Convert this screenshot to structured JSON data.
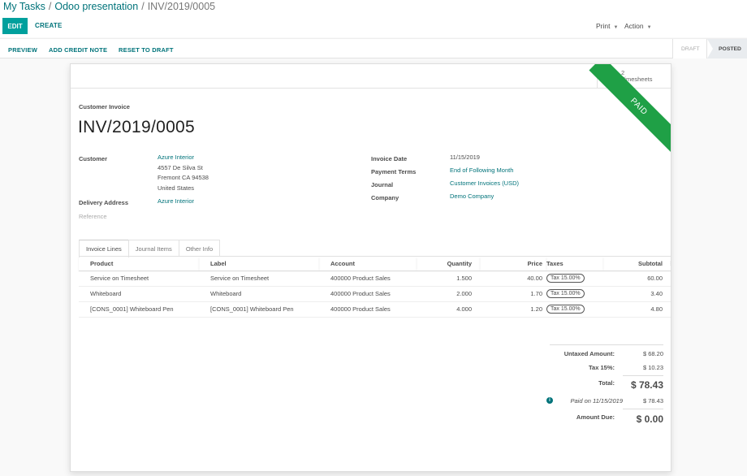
{
  "breadcrumb": [
    {
      "label": "My Tasks",
      "link": true
    },
    {
      "label": "Odoo presentation",
      "link": true
    },
    {
      "label": "INV/2019/0005",
      "link": false
    }
  ],
  "breadcrumb_separator": "/",
  "toolbar": {
    "edit_label": "EDIT",
    "create_label": "CREATE",
    "print_label": "Print",
    "action_label": "Action"
  },
  "statusbar": {
    "buttons": [
      "PREVIEW",
      "ADD CREDIT NOTE",
      "RESET TO DRAFT"
    ],
    "steps": [
      {
        "label": "DRAFT",
        "active": false
      },
      {
        "label": "POSTED",
        "active": true
      }
    ]
  },
  "smart_button": {
    "icon": "calendar-icon",
    "count": "2",
    "label": "Timesheets"
  },
  "ribbon": {
    "text": "PAID",
    "color": "#1fa046"
  },
  "document": {
    "type_label": "Customer Invoice",
    "number": "INV/2019/0005"
  },
  "left_fields": {
    "customer_label": "Customer",
    "customer_name": "Azure Interior",
    "customer_address": [
      "4557 De Silva St",
      "Fremont CA 94538",
      "United States"
    ],
    "delivery_label": "Delivery Address",
    "delivery_value": "Azure Interior",
    "reference_label": "Reference"
  },
  "right_fields": [
    {
      "label": "Invoice Date",
      "value": "11/15/2019",
      "link": false
    },
    {
      "label": "Payment Terms",
      "value": "End of Following Month",
      "link": true
    },
    {
      "label": "Journal",
      "value": "Customer Invoices (USD)",
      "link": true
    },
    {
      "label": "Company",
      "value": "Demo Company",
      "link": true
    }
  ],
  "tabs": [
    {
      "label": "Invoice Lines",
      "active": true
    },
    {
      "label": "Journal Items",
      "active": false
    },
    {
      "label": "Other Info",
      "active": false
    }
  ],
  "lines": {
    "headers": [
      "Product",
      "Label",
      "Account",
      "Quantity",
      "Price",
      "Taxes",
      "Subtotal"
    ],
    "rows": [
      {
        "product": "Service on Timesheet",
        "label": "Service on Timesheet",
        "account": "400000 Product Sales",
        "quantity": "1.500",
        "price": "40.00",
        "tax": "Tax 15.00%",
        "subtotal": "60.00"
      },
      {
        "product": "Whiteboard",
        "label": "Whiteboard",
        "account": "400000 Product Sales",
        "quantity": "2.000",
        "price": "1.70",
        "tax": "Tax 15.00%",
        "subtotal": "3.40"
      },
      {
        "product": "[CONS_0001] Whiteboard Pen",
        "label": "[CONS_0001] Whiteboard Pen",
        "account": "400000 Product Sales",
        "quantity": "4.000",
        "price": "1.20",
        "tax": "Tax 15.00%",
        "subtotal": "4.80"
      }
    ]
  },
  "totals": {
    "untaxed_label": "Untaxed Amount:",
    "untaxed_value": "$ 68.20",
    "tax_label": "Tax 15%:",
    "tax_value": "$ 10.23",
    "total_label": "Total:",
    "total_value": "$ 78.43",
    "paid_label": "Paid on 11/15/2019",
    "paid_value": "$ 78.43",
    "due_label": "Amount Due:",
    "due_value": "$ 0.00"
  },
  "colors": {
    "primary": "#00a09d",
    "link": "#00737a",
    "paid_ribbon": "#1fa046"
  }
}
